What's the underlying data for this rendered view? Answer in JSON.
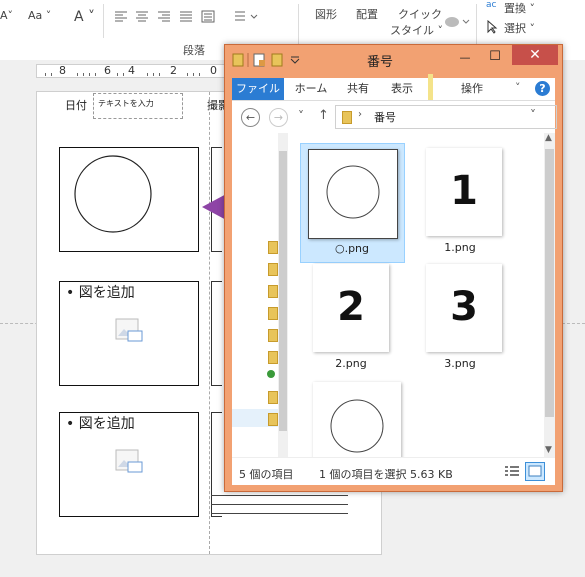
{
  "ribbon": {
    "font_shrink": "A˅",
    "font_case": "Aa ˅",
    "font_color": "A ˅",
    "shape": "図形",
    "arrange": "配置",
    "quick_style_line1": "クイック",
    "quick_style_line2": "スタイル ˅",
    "replace": "置換 ˅",
    "select": "選択 ˅",
    "group_paragraph": "段落"
  },
  "ruler": {
    "numbers": [
      "8",
      "6",
      "4",
      "2",
      "0"
    ]
  },
  "slide": {
    "header_date": "日付",
    "header_text_placeholder": "テキストを入力",
    "header_photo": "撮影",
    "bullet1": "• 図を追加",
    "bullet2": "• 図を追加"
  },
  "explorer": {
    "title": "番号",
    "tabs": [
      "ファイル",
      "ホーム",
      "共有",
      "表示",
      "操作"
    ],
    "breadcrumb": "番号",
    "files": [
      {
        "name": "○.png",
        "kind": "circle",
        "selected": true
      },
      {
        "name": "1.png",
        "kind": "number",
        "glyph": "1"
      },
      {
        "name": "2.png",
        "kind": "number",
        "glyph": "2"
      },
      {
        "name": "3.png",
        "kind": "number",
        "glyph": "3"
      },
      {
        "name": "",
        "kind": "circle"
      }
    ],
    "status_count": "5 個の項目",
    "status_selected": "1 個の項目を選択  5.63 KB"
  },
  "colors": {
    "window_frame": "#f2a172",
    "close_button": "#c7504a",
    "file_tab": "#2b7cd3",
    "arrow": "#8e44a6",
    "selection": "#cce8ff"
  }
}
